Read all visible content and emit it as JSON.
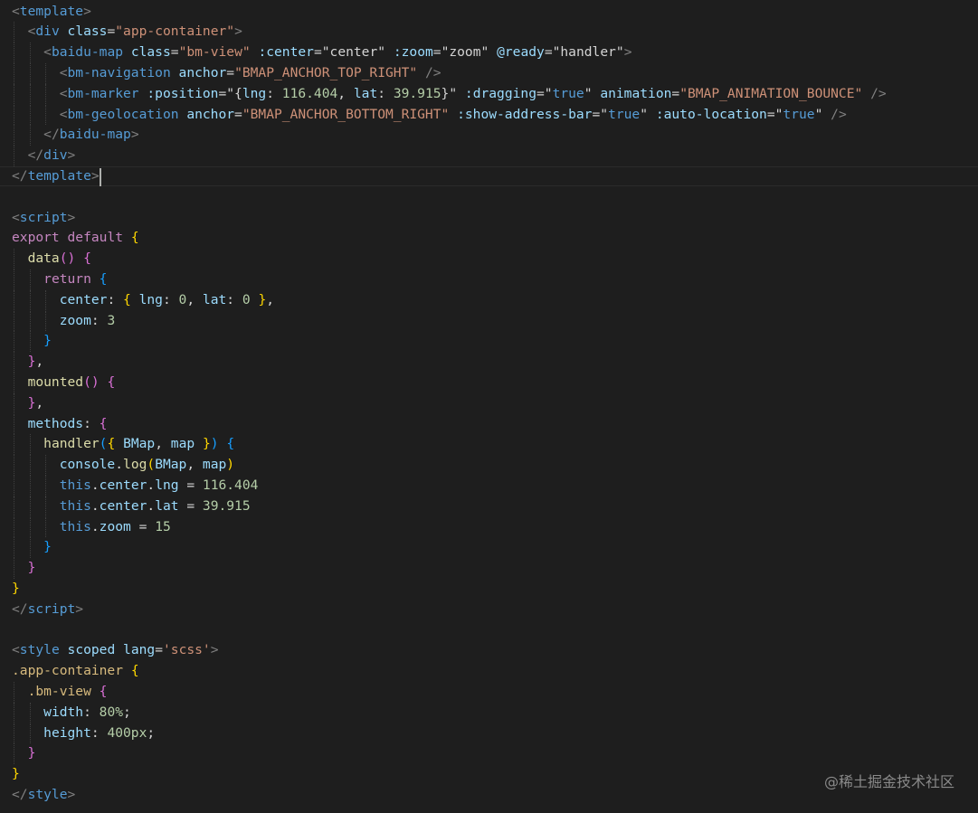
{
  "editor": {
    "lines": [
      [
        [
          "punct",
          "<"
        ],
        [
          "tag",
          "template"
        ],
        [
          "punct",
          ">"
        ]
      ],
      [
        [
          "text",
          "  "
        ],
        [
          "punct",
          "<"
        ],
        [
          "tag",
          "div"
        ],
        [
          "text",
          " "
        ],
        [
          "attr",
          "class"
        ],
        [
          "text",
          "="
        ],
        [
          "str",
          "\"app-container\""
        ],
        [
          "punct",
          ">"
        ]
      ],
      [
        [
          "text",
          "    "
        ],
        [
          "punct",
          "<"
        ],
        [
          "tag",
          "baidu-map"
        ],
        [
          "text",
          " "
        ],
        [
          "attr",
          "class"
        ],
        [
          "text",
          "="
        ],
        [
          "str",
          "\"bm-view\""
        ],
        [
          "text",
          " "
        ],
        [
          "attr",
          ":center"
        ],
        [
          "text",
          "="
        ],
        [
          "text",
          "\"center\""
        ],
        [
          "text",
          " "
        ],
        [
          "attr",
          ":zoom"
        ],
        [
          "text",
          "="
        ],
        [
          "text",
          "\"zoom\""
        ],
        [
          "text",
          " "
        ],
        [
          "attr",
          "@ready"
        ],
        [
          "text",
          "="
        ],
        [
          "text",
          "\"handler\""
        ],
        [
          "punct",
          ">"
        ]
      ],
      [
        [
          "text",
          "      "
        ],
        [
          "punct",
          "<"
        ],
        [
          "tag",
          "bm-navigation"
        ],
        [
          "text",
          " "
        ],
        [
          "attr",
          "anchor"
        ],
        [
          "text",
          "="
        ],
        [
          "str",
          "\"BMAP_ANCHOR_TOP_RIGHT\""
        ],
        [
          "text",
          " "
        ],
        [
          "punct",
          "/>"
        ]
      ],
      [
        [
          "text",
          "      "
        ],
        [
          "punct",
          "<"
        ],
        [
          "tag",
          "bm-marker"
        ],
        [
          "text",
          " "
        ],
        [
          "attr",
          ":position"
        ],
        [
          "text",
          "="
        ],
        [
          "text",
          "\"{"
        ],
        [
          "prop",
          "lng"
        ],
        [
          "text",
          ": "
        ],
        [
          "num",
          "116.404"
        ],
        [
          "text",
          ", "
        ],
        [
          "prop",
          "lat"
        ],
        [
          "text",
          ": "
        ],
        [
          "num",
          "39.915"
        ],
        [
          "text",
          "}\""
        ],
        [
          "text",
          " "
        ],
        [
          "attr",
          ":dragging"
        ],
        [
          "text",
          "="
        ],
        [
          "text",
          "\""
        ],
        [
          "tag",
          "true"
        ],
        [
          "text",
          "\""
        ],
        [
          "text",
          " "
        ],
        [
          "attr",
          "animation"
        ],
        [
          "text",
          "="
        ],
        [
          "str",
          "\"BMAP_ANIMATION_BOUNCE\""
        ],
        [
          "text",
          " "
        ],
        [
          "punct",
          "/>"
        ]
      ],
      [
        [
          "text",
          "      "
        ],
        [
          "punct",
          "<"
        ],
        [
          "tag",
          "bm-geolocation"
        ],
        [
          "text",
          " "
        ],
        [
          "attr",
          "anchor"
        ],
        [
          "text",
          "="
        ],
        [
          "str",
          "\"BMAP_ANCHOR_BOTTOM_RIGHT\""
        ],
        [
          "text",
          " "
        ],
        [
          "attr",
          ":show-address-bar"
        ],
        [
          "text",
          "="
        ],
        [
          "text",
          "\""
        ],
        [
          "tag",
          "true"
        ],
        [
          "text",
          "\""
        ],
        [
          "text",
          " "
        ],
        [
          "attr",
          ":auto-location"
        ],
        [
          "text",
          "="
        ],
        [
          "text",
          "\""
        ],
        [
          "tag",
          "true"
        ],
        [
          "text",
          "\""
        ],
        [
          "text",
          " "
        ],
        [
          "punct",
          "/>"
        ]
      ],
      [
        [
          "text",
          "    "
        ],
        [
          "punct",
          "</"
        ],
        [
          "tag",
          "baidu-map"
        ],
        [
          "punct",
          ">"
        ]
      ],
      [
        [
          "text",
          "  "
        ],
        [
          "punct",
          "</"
        ],
        [
          "tag",
          "div"
        ],
        [
          "punct",
          ">"
        ]
      ],
      [
        [
          "punct",
          "</"
        ],
        [
          "tag",
          "template"
        ],
        [
          "punct",
          ">"
        ]
      ],
      [],
      [
        [
          "punct",
          "<"
        ],
        [
          "tag",
          "script"
        ],
        [
          "punct",
          ">"
        ]
      ],
      [
        [
          "kw",
          "export"
        ],
        [
          "text",
          " "
        ],
        [
          "kw",
          "default"
        ],
        [
          "text",
          " "
        ],
        [
          "b1",
          "{"
        ]
      ],
      [
        [
          "text",
          "  "
        ],
        [
          "fn",
          "data"
        ],
        [
          "b2",
          "()"
        ],
        [
          "text",
          " "
        ],
        [
          "b2",
          "{"
        ]
      ],
      [
        [
          "text",
          "    "
        ],
        [
          "kw",
          "return"
        ],
        [
          "text",
          " "
        ],
        [
          "b3",
          "{"
        ]
      ],
      [
        [
          "text",
          "      "
        ],
        [
          "prop",
          "center"
        ],
        [
          "text",
          ": "
        ],
        [
          "b1",
          "{"
        ],
        [
          "text",
          " "
        ],
        [
          "prop",
          "lng"
        ],
        [
          "text",
          ": "
        ],
        [
          "num",
          "0"
        ],
        [
          "text",
          ", "
        ],
        [
          "prop",
          "lat"
        ],
        [
          "text",
          ": "
        ],
        [
          "num",
          "0"
        ],
        [
          "text",
          " "
        ],
        [
          "b1",
          "}"
        ],
        [
          "text",
          ","
        ]
      ],
      [
        [
          "text",
          "      "
        ],
        [
          "prop",
          "zoom"
        ],
        [
          "text",
          ": "
        ],
        [
          "num",
          "3"
        ]
      ],
      [
        [
          "text",
          "    "
        ],
        [
          "b3",
          "}"
        ]
      ],
      [
        [
          "text",
          "  "
        ],
        [
          "b2",
          "}"
        ],
        [
          "text",
          ","
        ]
      ],
      [
        [
          "text",
          "  "
        ],
        [
          "fn",
          "mounted"
        ],
        [
          "b2",
          "()"
        ],
        [
          "text",
          " "
        ],
        [
          "b2",
          "{"
        ]
      ],
      [
        [
          "text",
          "  "
        ],
        [
          "b2",
          "}"
        ],
        [
          "text",
          ","
        ]
      ],
      [
        [
          "text",
          "  "
        ],
        [
          "prop",
          "methods"
        ],
        [
          "text",
          ": "
        ],
        [
          "b2",
          "{"
        ]
      ],
      [
        [
          "text",
          "    "
        ],
        [
          "fn",
          "handler"
        ],
        [
          "b3",
          "("
        ],
        [
          "b1",
          "{"
        ],
        [
          "text",
          " "
        ],
        [
          "prop",
          "BMap"
        ],
        [
          "text",
          ", "
        ],
        [
          "prop",
          "map"
        ],
        [
          "text",
          " "
        ],
        [
          "b1",
          "}"
        ],
        [
          "b3",
          ")"
        ],
        [
          "text",
          " "
        ],
        [
          "b3",
          "{"
        ]
      ],
      [
        [
          "text",
          "      "
        ],
        [
          "prop",
          "console"
        ],
        [
          "text",
          "."
        ],
        [
          "fn",
          "log"
        ],
        [
          "b1",
          "("
        ],
        [
          "prop",
          "BMap"
        ],
        [
          "text",
          ", "
        ],
        [
          "prop",
          "map"
        ],
        [
          "b1",
          ")"
        ]
      ],
      [
        [
          "text",
          "      "
        ],
        [
          "this",
          "this"
        ],
        [
          "text",
          "."
        ],
        [
          "prop",
          "center"
        ],
        [
          "text",
          "."
        ],
        [
          "prop",
          "lng"
        ],
        [
          "text",
          " = "
        ],
        [
          "num",
          "116.404"
        ]
      ],
      [
        [
          "text",
          "      "
        ],
        [
          "this",
          "this"
        ],
        [
          "text",
          "."
        ],
        [
          "prop",
          "center"
        ],
        [
          "text",
          "."
        ],
        [
          "prop",
          "lat"
        ],
        [
          "text",
          " = "
        ],
        [
          "num",
          "39.915"
        ]
      ],
      [
        [
          "text",
          "      "
        ],
        [
          "this",
          "this"
        ],
        [
          "text",
          "."
        ],
        [
          "prop",
          "zoom"
        ],
        [
          "text",
          " = "
        ],
        [
          "num",
          "15"
        ]
      ],
      [
        [
          "text",
          "    "
        ],
        [
          "b3",
          "}"
        ]
      ],
      [
        [
          "text",
          "  "
        ],
        [
          "b2",
          "}"
        ]
      ],
      [
        [
          "b1",
          "}"
        ]
      ],
      [
        [
          "punct",
          "</"
        ],
        [
          "tag",
          "script"
        ],
        [
          "punct",
          ">"
        ]
      ],
      [],
      [
        [
          "punct",
          "<"
        ],
        [
          "tag",
          "style"
        ],
        [
          "text",
          " "
        ],
        [
          "attr",
          "scoped"
        ],
        [
          "text",
          " "
        ],
        [
          "attr",
          "lang"
        ],
        [
          "text",
          "="
        ],
        [
          "str",
          "'scss'"
        ],
        [
          "punct",
          ">"
        ]
      ],
      [
        [
          "sel",
          ".app-container"
        ],
        [
          "text",
          " "
        ],
        [
          "b1",
          "{"
        ]
      ],
      [
        [
          "text",
          "  "
        ],
        [
          "sel",
          ".bm-view"
        ],
        [
          "text",
          " "
        ],
        [
          "b2",
          "{"
        ]
      ],
      [
        [
          "text",
          "    "
        ],
        [
          "prop",
          "width"
        ],
        [
          "text",
          ": "
        ],
        [
          "num",
          "80%"
        ],
        [
          "text",
          ";"
        ]
      ],
      [
        [
          "text",
          "    "
        ],
        [
          "prop",
          "height"
        ],
        [
          "text",
          ": "
        ],
        [
          "num",
          "400px"
        ],
        [
          "text",
          ";"
        ]
      ],
      [
        [
          "text",
          "  "
        ],
        [
          "b2",
          "}"
        ]
      ],
      [
        [
          "b1",
          "}"
        ]
      ],
      [
        [
          "punct",
          "</"
        ],
        [
          "tag",
          "style"
        ],
        [
          "punct",
          ">"
        ]
      ]
    ]
  },
  "watermark": "@稀土掘金技术社区"
}
